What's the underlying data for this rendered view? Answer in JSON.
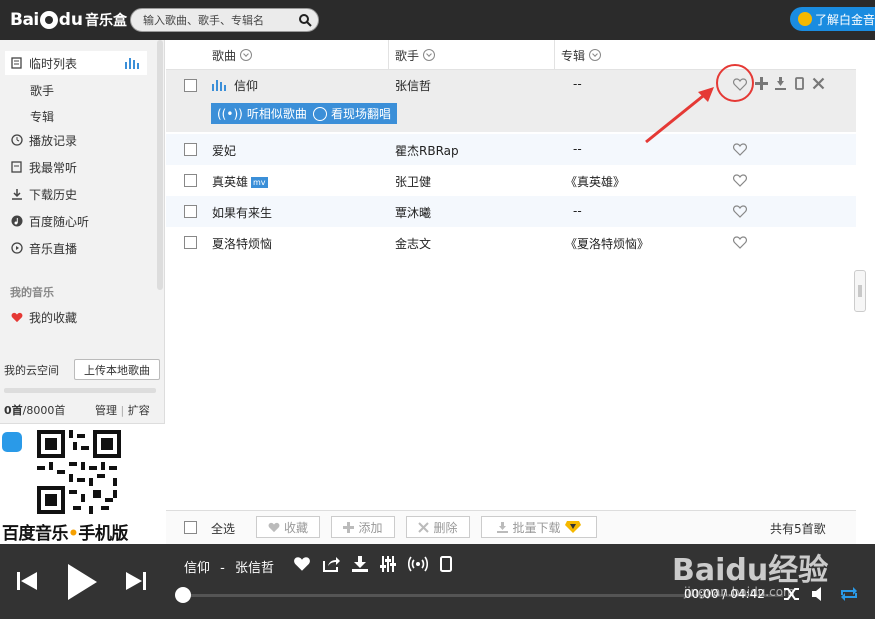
{
  "app": {
    "logo_bai": "Bai",
    "logo_du": "du",
    "logo_music": "音乐盒",
    "search_placeholder": "输入歌曲、歌手、专辑名",
    "promo_label": "了解白金音"
  },
  "sidebar": {
    "items": [
      {
        "label": "临时列表",
        "icon": "playlist-icon"
      },
      {
        "label": "歌手"
      },
      {
        "label": "专辑"
      },
      {
        "label": "播放记录",
        "icon": "clock-icon"
      },
      {
        "label": "我最常听",
        "icon": "list-icon"
      },
      {
        "label": "下载历史",
        "icon": "download-icon"
      },
      {
        "label": "百度随心听",
        "icon": "music-note-icon"
      },
      {
        "label": "音乐直播",
        "icon": "play-circle-icon"
      }
    ],
    "my_music_label": "我的音乐",
    "favorites_label": "我的收藏",
    "cloud_title": "我的云空间",
    "upload_label": "上传本地歌曲",
    "quota_used": "0首",
    "quota_total": "/8000首",
    "manage_label": "管理",
    "expand_label": "扩容",
    "qr_caption_a": "百度音乐",
    "qr_caption_dot": "•",
    "qr_caption_b": "手机版"
  },
  "list": {
    "columns": [
      "歌曲",
      "歌手",
      "专辑"
    ],
    "rows": [
      {
        "song": "信仰",
        "artist": "张信哲",
        "album": "--",
        "playing": true
      },
      {
        "song": "爱妃",
        "artist": "瞿杰RBRap",
        "album": "--"
      },
      {
        "song": "真英雄",
        "artist": "张卫健",
        "album": "《真英雄》",
        "mv": "mv"
      },
      {
        "song": "如果有来生",
        "artist": "覃沐曦",
        "album": "--"
      },
      {
        "song": "夏洛特烦恼",
        "artist": "金志文",
        "album": "《夏洛特烦恼》"
      }
    ],
    "similar_label": "听相似歌曲",
    "live_label": "看现场翻唱"
  },
  "footer": {
    "select_all": "全选",
    "favorite": "收藏",
    "add": "添加",
    "delete": "删除",
    "batch_download": "批量下载",
    "total": "共有5首歌"
  },
  "player": {
    "now_song": "信仰",
    "separator": "-",
    "now_artist": "张信哲",
    "time": "00:00 / 04:42",
    "progress": 0
  },
  "watermark": {
    "main": "Baidu经验",
    "sub": "jingyan.baidu.com"
  },
  "colors": {
    "topbar": "#2b2b2b",
    "accent": "#3b8fd8",
    "annotation": "#e53935",
    "player": "#333333"
  }
}
